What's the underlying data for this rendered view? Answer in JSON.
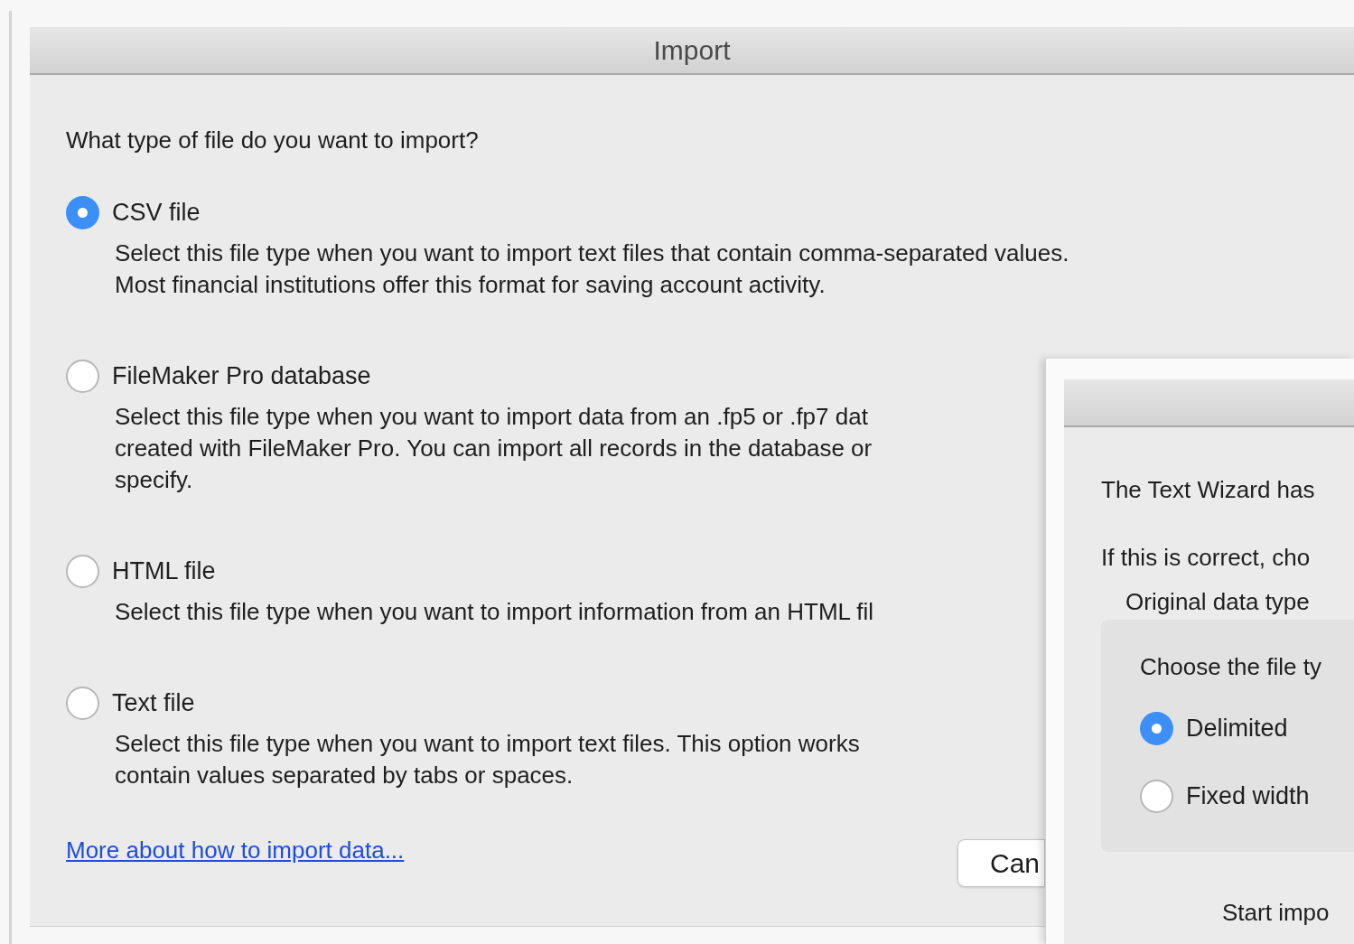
{
  "window": {
    "title": "Import"
  },
  "question": "What type of file do you want to import?",
  "options": [
    {
      "label": "CSV file",
      "selected": true,
      "description": [
        "Select this file type when you want to import text files that contain comma-separated values.",
        "Most financial institutions offer this format for saving account activity."
      ]
    },
    {
      "label": "FileMaker Pro database",
      "selected": false,
      "description": [
        "Select this file type when you want to import data from an .fp5 or .fp7 dat",
        "created with FileMaker Pro.  You can import all records in the database or",
        "specify."
      ]
    },
    {
      "label": "HTML file",
      "selected": false,
      "description": [
        "Select this file type when you want to import information from an HTML fil"
      ]
    },
    {
      "label": "Text file",
      "selected": false,
      "description": [
        "Select this file type when you want to import text files.  This option works",
        "contain values separated by tabs or spaces."
      ]
    }
  ],
  "help_link": "More about how to import data...",
  "buttons": [
    "Can"
  ],
  "wizard": {
    "lines": [
      "The Text Wizard has",
      "If this is correct, cho"
    ],
    "group_title": "Original data type",
    "prompt": "Choose the file ty",
    "choices": [
      {
        "label": "Delimited",
        "selected": true
      },
      {
        "label": "Fixed width",
        "selected": false
      }
    ],
    "footer": "Start impo"
  }
}
